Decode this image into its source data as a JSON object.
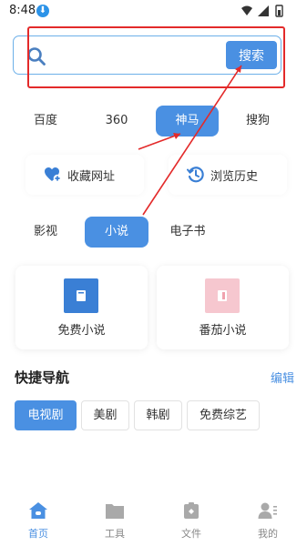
{
  "status_bar": {
    "time": "8:48",
    "download_badge": "⬇"
  },
  "search": {
    "placeholder": "",
    "value": "",
    "button_label": "搜索"
  },
  "engines": [
    {
      "label": "百度",
      "active": false
    },
    {
      "label": "360",
      "active": false
    },
    {
      "label": "神马",
      "active": true
    },
    {
      "label": "搜狗",
      "active": false
    }
  ],
  "quick_actions": {
    "favorites_label": "收藏网址",
    "history_label": "浏览历史"
  },
  "categories": [
    {
      "label": "影视",
      "active": false
    },
    {
      "label": "小说",
      "active": true
    },
    {
      "label": "电子书",
      "active": false
    }
  ],
  "books": [
    {
      "label": "免费小说",
      "cover_color": "#3a7fd5"
    },
    {
      "label": "番茄小说",
      "cover_color": "#f6c7cf"
    }
  ],
  "quick_nav": {
    "title": "快捷导航",
    "edit_label": "编辑",
    "tags": [
      {
        "label": "电视剧",
        "active": true
      },
      {
        "label": "美剧",
        "active": false
      },
      {
        "label": "韩剧",
        "active": false
      },
      {
        "label": "免费综艺",
        "active": false
      }
    ]
  },
  "bottom_nav": [
    {
      "label": "首页",
      "icon": "home-icon",
      "active": true
    },
    {
      "label": "工具",
      "icon": "folder-icon",
      "active": false
    },
    {
      "label": "文件",
      "icon": "file-icon",
      "active": false
    },
    {
      "label": "我的",
      "icon": "user-icon",
      "active": false
    }
  ],
  "colors": {
    "accent": "#4a90e2",
    "annotation": "#e32a2a"
  }
}
